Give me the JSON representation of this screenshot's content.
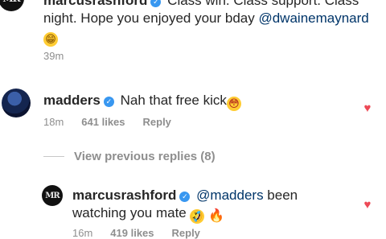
{
  "comments": [
    {
      "username": "marcusrashford",
      "avatar_text": "MR",
      "text_before": "Class win. Class support. Class night. Hope you enjoyed your bday ",
      "mention": "@dwainemaynard",
      "emoji": "😁",
      "time": "39m"
    },
    {
      "username": "madders",
      "text": "Nah that free kick",
      "emoji": "😳",
      "time": "18m",
      "likes": "641 likes",
      "reply": "Reply",
      "liked": true
    },
    {
      "username": "marcusrashford",
      "avatar_text": "MR",
      "mention": "@madders",
      "text_after": " been watching you mate ",
      "emoji1": "🤣",
      "emoji2": "🔥",
      "time": "16m",
      "likes": "419 likes",
      "reply": "Reply",
      "liked": true
    }
  ],
  "view_previous": "View previous replies (8)",
  "colors": {
    "heart": "#ed4956",
    "verified": "#3897f0",
    "meta": "#8e8e8e",
    "text": "#262626"
  },
  "icons": {
    "verified": "verified-badge-icon",
    "heart": "heart-icon"
  }
}
